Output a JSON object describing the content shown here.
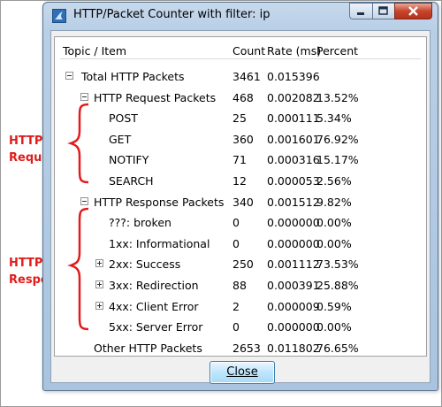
{
  "window": {
    "title": "HTTP/Packet Counter with filter: ip"
  },
  "columns": {
    "topic": "Topic / Item",
    "count": "Count",
    "rate": "Rate (ms)",
    "percent": "Percent"
  },
  "rows": [
    {
      "label": "Total HTTP Packets",
      "count": "3461",
      "rate": "0.015396",
      "percent": "",
      "expander": "minus"
    },
    {
      "label": "HTTP Request Packets",
      "count": "468",
      "rate": "0.002082",
      "percent": "13.52%",
      "expander": "minus"
    },
    {
      "label": "POST",
      "count": "25",
      "rate": "0.000111",
      "percent": "5.34%",
      "expander": ""
    },
    {
      "label": "GET",
      "count": "360",
      "rate": "0.001601",
      "percent": "76.92%",
      "expander": ""
    },
    {
      "label": "NOTIFY",
      "count": "71",
      "rate": "0.000316",
      "percent": "15.17%",
      "expander": ""
    },
    {
      "label": "SEARCH",
      "count": "12",
      "rate": "0.000053",
      "percent": "2.56%",
      "expander": ""
    },
    {
      "label": "HTTP Response Packets",
      "count": "340",
      "rate": "0.001512",
      "percent": "9.82%",
      "expander": "minus"
    },
    {
      "label": "???: broken",
      "count": "0",
      "rate": "0.000000",
      "percent": "0.00%",
      "expander": ""
    },
    {
      "label": "1xx: Informational",
      "count": "0",
      "rate": "0.000000",
      "percent": "0.00%",
      "expander": ""
    },
    {
      "label": "2xx: Success",
      "count": "250",
      "rate": "0.001112",
      "percent": "73.53%",
      "expander": "plus"
    },
    {
      "label": "3xx: Redirection",
      "count": "88",
      "rate": "0.000391",
      "percent": "25.88%",
      "expander": "plus"
    },
    {
      "label": "4xx: Client Error",
      "count": "2",
      "rate": "0.000009",
      "percent": "0.59%",
      "expander": "plus"
    },
    {
      "label": "5xx: Server Error",
      "count": "0",
      "rate": "0.000000",
      "percent": "0.00%",
      "expander": ""
    },
    {
      "label": "Other HTTP Packets",
      "count": "2653",
      "rate": "0.011802",
      "percent": "76.65%",
      "expander": ""
    }
  ],
  "buttons": {
    "close": "Close"
  },
  "annotations": {
    "requests": [
      "HTTP",
      "Requests"
    ],
    "responses": [
      "HTTP",
      "Responses"
    ]
  },
  "colors": {
    "annotation": "#e21b1b"
  }
}
